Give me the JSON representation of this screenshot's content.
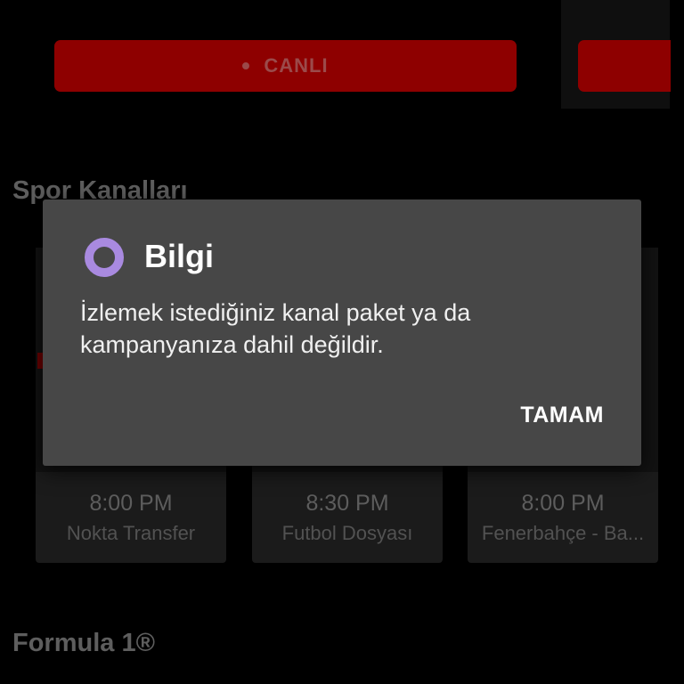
{
  "top": {
    "live_button_label": "CANLI"
  },
  "sections": {
    "sports_title": "Spor Kanalları",
    "f1_title": "Formula 1®"
  },
  "programs": [
    {
      "time": "8:00 PM",
      "name": "Nokta Transfer"
    },
    {
      "time": "8:30 PM",
      "name": "Futbol Dosyası"
    },
    {
      "time": "8:00 PM",
      "name": "Fenerbahçe - Ba..."
    }
  ],
  "dialog": {
    "title": "Bilgi",
    "message": "İzlemek istediğiniz kanal paket ya da kampanyanıza dahil değildir.",
    "ok_label": "TAMAM",
    "icon": "info-ring-icon"
  },
  "colors": {
    "accent_red": "#8e0000",
    "dialog_bg": "#474747",
    "icon_ring": "#a98ae0"
  }
}
